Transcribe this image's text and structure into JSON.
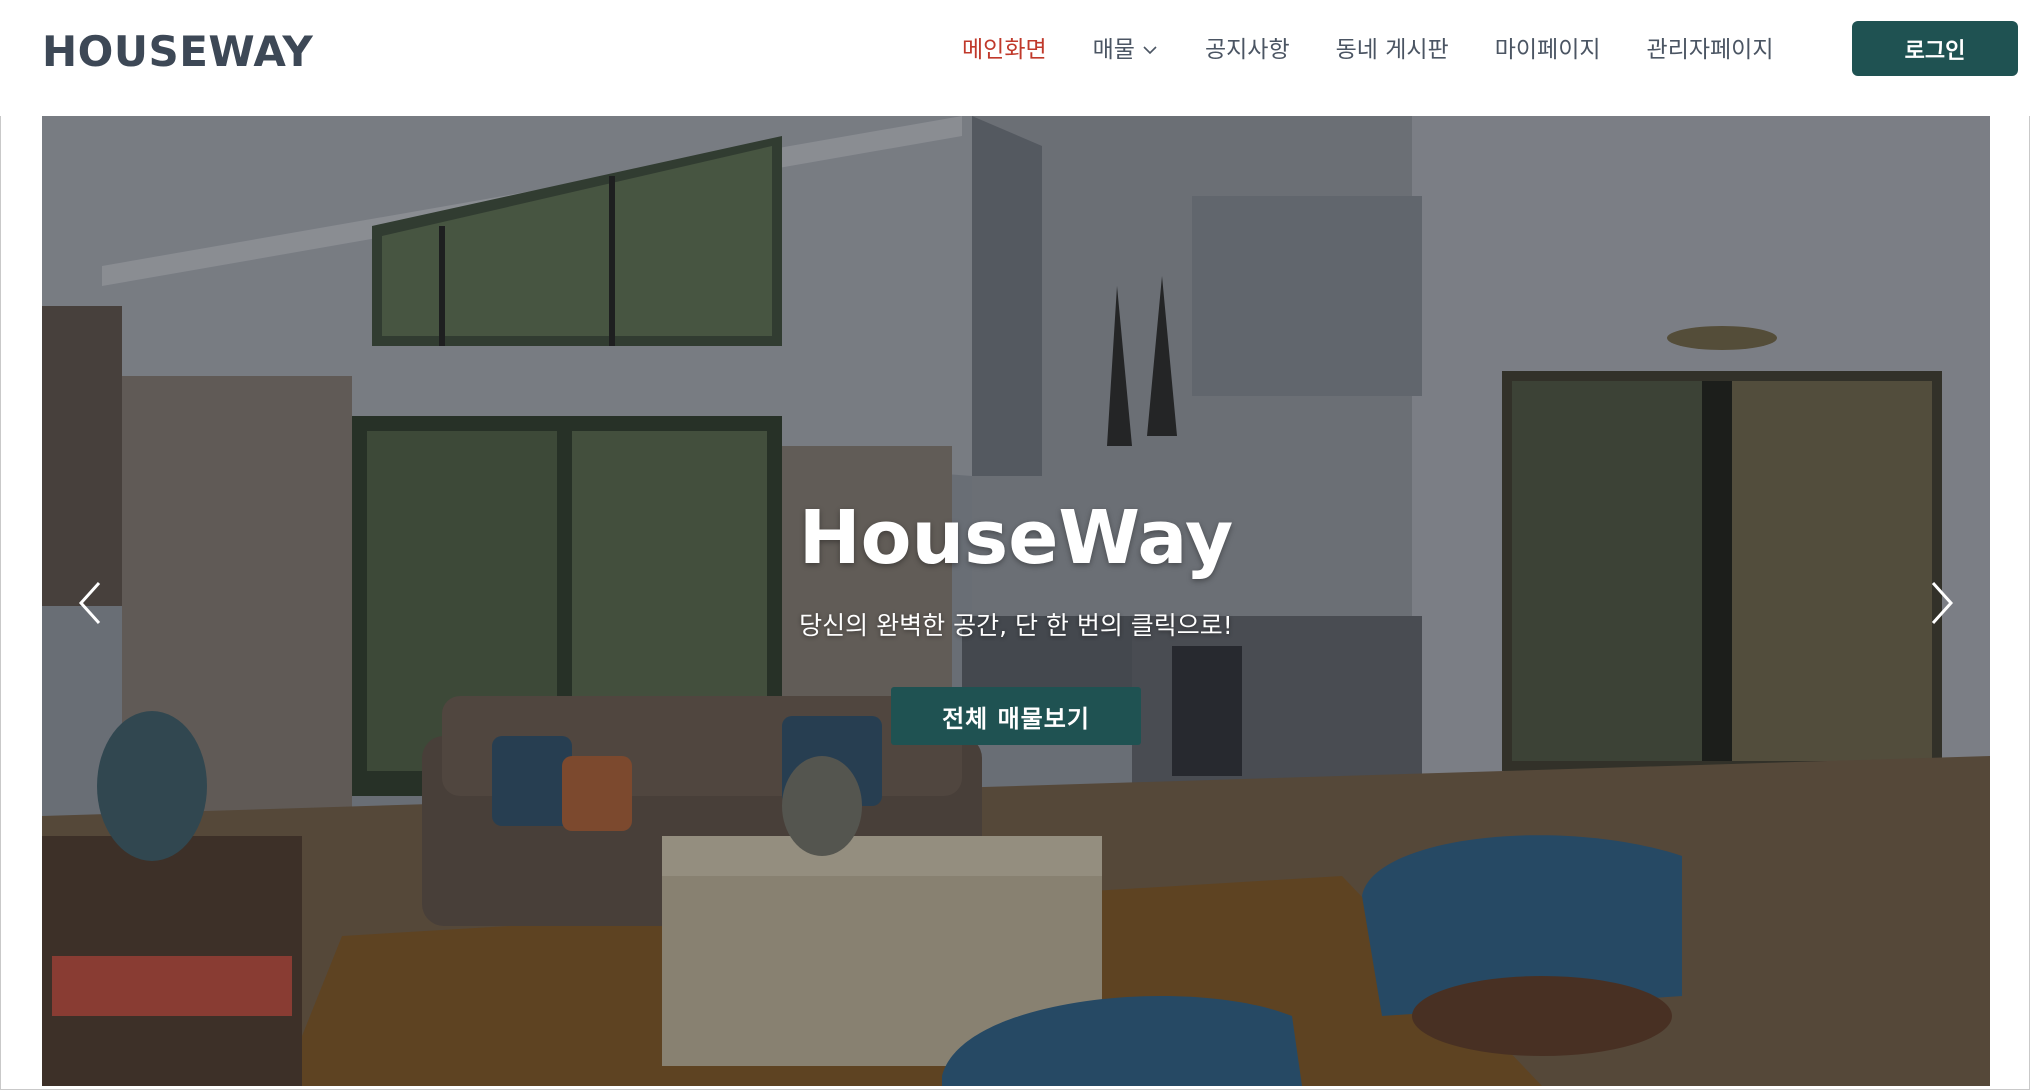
{
  "header": {
    "logo": "HOUSEWAY",
    "nav": [
      {
        "label": "메인화면",
        "active": true,
        "has_dropdown": false
      },
      {
        "label": "매물",
        "active": false,
        "has_dropdown": true
      },
      {
        "label": "공지사항",
        "active": false,
        "has_dropdown": false
      },
      {
        "label": "동네 게시판",
        "active": false,
        "has_dropdown": false
      },
      {
        "label": "마이페이지",
        "active": false,
        "has_dropdown": false
      },
      {
        "label": "관리자페이지",
        "active": false,
        "has_dropdown": false
      }
    ],
    "login_label": "로그인"
  },
  "hero": {
    "title": "HouseWay",
    "subtitle": "당신의 완벽한 공간, 단 한 번의 클릭으로!",
    "cta_label": "전체 매물보기",
    "prev_icon": "chevron-left-icon",
    "next_icon": "chevron-right-icon"
  },
  "colors": {
    "brand": "#1f5252",
    "active_nav": "#c0392b",
    "nav_text": "#4b5563",
    "logo_text": "#3d4856"
  }
}
